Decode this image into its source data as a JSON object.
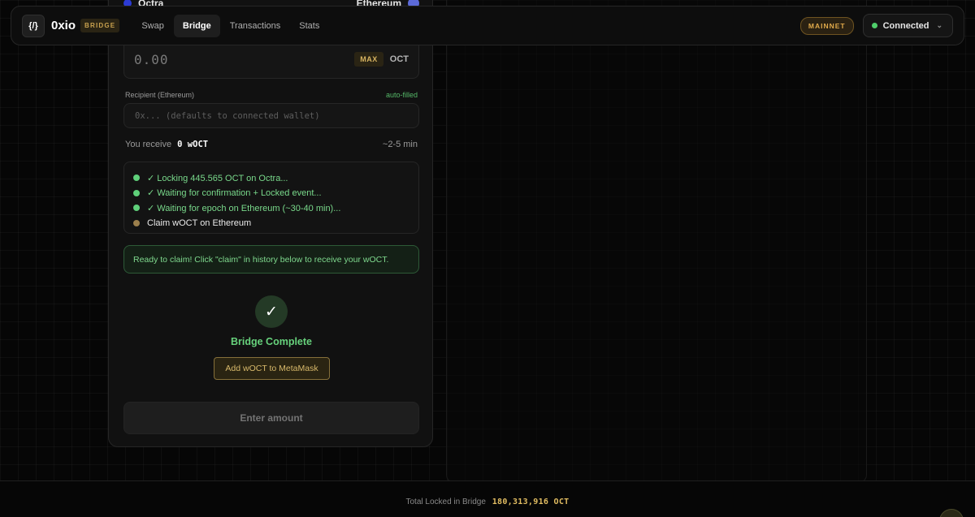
{
  "header": {
    "logo_glyph": "{/}",
    "brand": "0xio",
    "badge": "BRIDGE",
    "nav": [
      "Swap",
      "Bridge",
      "Transactions",
      "Stats"
    ],
    "active_nav": "Bridge",
    "network": "MAINNET",
    "wallet_status": "Connected",
    "wallet_chevron": "⌄"
  },
  "bridge": {
    "from_chain": "Octra",
    "to_chain": "Ethereum",
    "amount_value": "0.00",
    "max_label": "MAX",
    "amount_unit": "OCT",
    "recipient_label": "Recipient (Ethereum)",
    "recipient_autofill": "auto-filled",
    "recipient_placeholder": "0x... (defaults to connected wallet)",
    "receive_label": "You receive",
    "receive_amount": "0 wOCT",
    "eta": "~2-5 min",
    "steps": [
      {
        "text": "✓ Locking 445.565 OCT on Octra...",
        "status": "done"
      },
      {
        "text": "✓ Waiting for confirmation + Locked event...",
        "status": "done"
      },
      {
        "text": "✓ Waiting for epoch on Ethereum (~30-40 min)...",
        "status": "done"
      },
      {
        "text": "Claim wOCT on Ethereum",
        "status": "pending"
      }
    ],
    "notice": "Ready to claim! Click \"claim\" in history below to receive your wOCT.",
    "complete_icon": "✓",
    "complete_title": "Bridge Complete",
    "metamask_label": "Add wOCT to MetaMask",
    "submit_label": "Enter amount"
  },
  "footer": {
    "label": "Total Locked in Bridge",
    "value": "180,313,916 OCT"
  },
  "colors": {
    "accent_gold": "#d8b461",
    "success_green": "#5fd07a",
    "background": "#060606"
  }
}
